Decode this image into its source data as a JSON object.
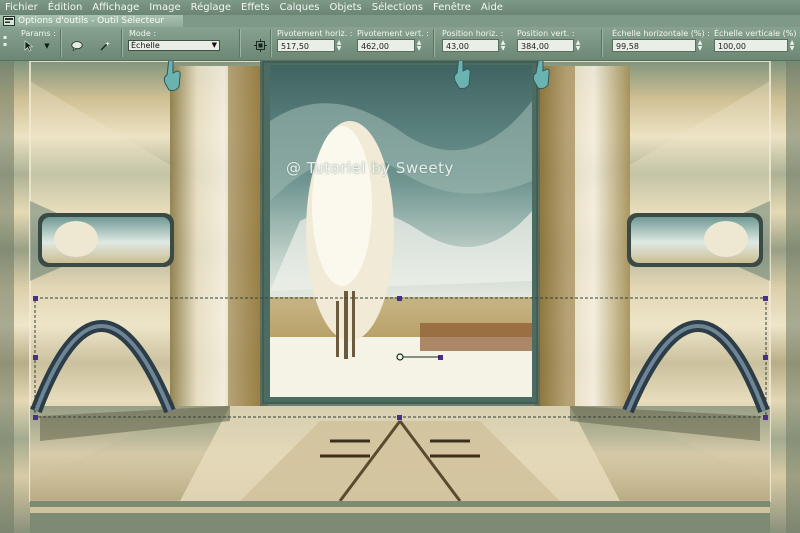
{
  "menu": {
    "items": [
      "Fichier",
      "Édition",
      "Affichage",
      "Image",
      "Réglage",
      "Effets",
      "Calques",
      "Objets",
      "Sélections",
      "Fenêtre",
      "Aide"
    ]
  },
  "tool_options": {
    "title": "Options d'outils - Outil Sélecteur",
    "params_label": "Params :",
    "mode_label": "Mode :",
    "mode_value": "Échelle",
    "fields": [
      {
        "label": "Pivotement horiz. :",
        "value": "517,50"
      },
      {
        "label": "Pivotement vert. :",
        "value": "462,00"
      },
      {
        "label": "Position horiz. :",
        "value": "43,00"
      },
      {
        "label": "Position vert. :",
        "value": "384,00"
      },
      {
        "label": "Échelle horizontale (%) :",
        "value": "99,58"
      },
      {
        "label": "Échelle verticale (%) :",
        "value": "100,00"
      }
    ]
  },
  "canvas": {
    "watermark": "@ Tutoriel by Sweety"
  },
  "icons": {
    "tool_options_window": "tool-options-window-icon",
    "pointer": "pointer-tool-icon",
    "speech_bubble": "speech-bubble-icon",
    "wand": "selection-wand-icon",
    "center": "center-object-icon",
    "hand": "pointing-hand-icon"
  },
  "colors": {
    "menu_bg": "#6a8672",
    "toolbar_bg": "#7d9985",
    "selection_handle": "#4a2f8a",
    "canvas_sky": "#5f8a84",
    "canvas_sand": "#d8cba8"
  }
}
